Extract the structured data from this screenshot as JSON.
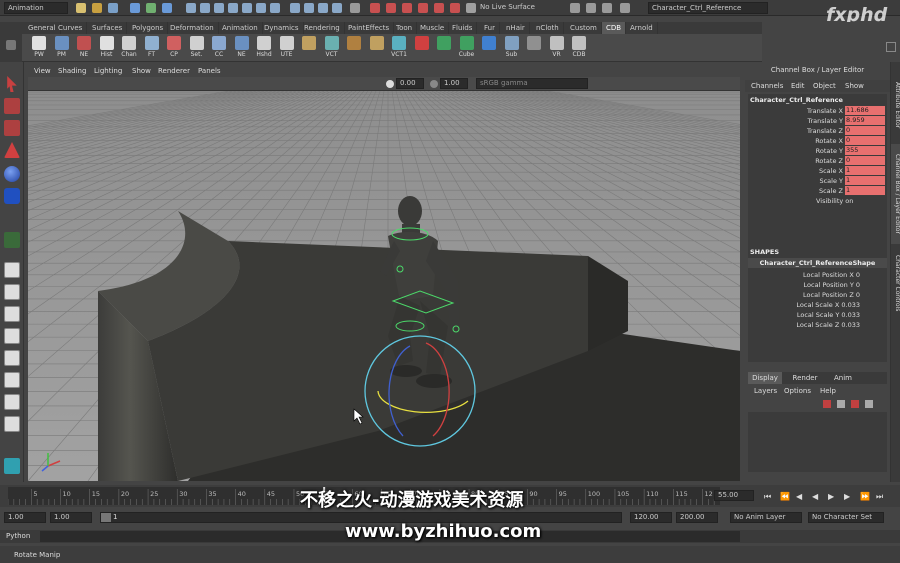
{
  "status_line": {
    "menu_set": "Animation",
    "live_surface": "No Live Surface",
    "selected_object": "Character_Ctrl_Reference"
  },
  "shelf_tabs": [
    "General",
    "Curves",
    "Surfaces",
    "Polygons",
    "Deformation",
    "Animation",
    "Dynamics",
    "Rendering",
    "PaintEffects",
    "Toon",
    "Muscle",
    "Fluids",
    "Fur",
    "nHair",
    "nCloth",
    "Custom",
    "CDB",
    "Arnold"
  ],
  "active_shelf_tab": "CDB",
  "shelf_items": [
    "PW",
    "PM",
    "NE",
    "Hist",
    "Chan",
    "FT",
    "CP",
    "Set.",
    "CC",
    "NE",
    "Hshd",
    "UTE",
    "",
    "VCT",
    "",
    "",
    "VCT1",
    "",
    "",
    "Cube",
    "",
    "Sub",
    "",
    "VR",
    "CDB"
  ],
  "viewport": {
    "menu": [
      "View",
      "Shading",
      "Lighting",
      "Show",
      "Renderer",
      "Panels"
    ],
    "exposure": "0.00",
    "gamma": "1.00",
    "color_space": "sRGB gamma"
  },
  "channel_box": {
    "title": "Channel Box / Layer Editor",
    "menu": [
      "Channels",
      "Edit",
      "Object",
      "Show"
    ],
    "object_name": "Character_Ctrl_Reference",
    "channels": [
      {
        "name": "Translate X",
        "value": "11.686"
      },
      {
        "name": "Translate Y",
        "value": "8.959"
      },
      {
        "name": "Translate Z",
        "value": "0"
      },
      {
        "name": "Rotate X",
        "value": "0"
      },
      {
        "name": "Rotate Y",
        "value": "355"
      },
      {
        "name": "Rotate Z",
        "value": "0"
      },
      {
        "name": "Scale X",
        "value": "1"
      },
      {
        "name": "Scale Y",
        "value": "1"
      },
      {
        "name": "Scale Z",
        "value": "1"
      }
    ],
    "visibility": "Visibility on",
    "shapes_header": "SHAPES",
    "shape_name": "Character_Ctrl_ReferenceShape",
    "shape_channels": [
      "Local Position X 0",
      "Local Position Y 0",
      "Local Position Z 0",
      "Local Scale X 0.033",
      "Local Scale Y 0.033",
      "Local Scale Z 0.033"
    ]
  },
  "layer_editor": {
    "tabs": [
      "Display",
      "Render",
      "Anim"
    ],
    "menu": [
      "Layers",
      "Options",
      "Help"
    ]
  },
  "side_tabs": [
    "Attribute Editor",
    "Channel Box / Layer Editor",
    "Character Controls"
  ],
  "timeline": {
    "ticks": [
      "5",
      "10",
      "15",
      "20",
      "25",
      "30",
      "35",
      "40",
      "45",
      "50",
      "55",
      "60",
      "65",
      "70",
      "75",
      "80",
      "85",
      "90",
      "95",
      "100",
      "105",
      "110",
      "115",
      "12"
    ],
    "current_frame": "55.00"
  },
  "range": {
    "start": "1.00",
    "inner_start": "1.00",
    "slider_value": "1",
    "inner_end": "120.00",
    "end": "200.00",
    "anim_layer": "No Anim Layer",
    "char_set": "No Character Set"
  },
  "command_line": {
    "label": "Python"
  },
  "help_line": "Rotate Manip",
  "watermarks": {
    "logo": "fxphd",
    "caption": "不移之火-动漫游戏美术资源",
    "url": "www.byzhihuo.com"
  },
  "colors": {
    "keyed_channel": "#e8706f",
    "active_tab": "#5a5a5a"
  }
}
